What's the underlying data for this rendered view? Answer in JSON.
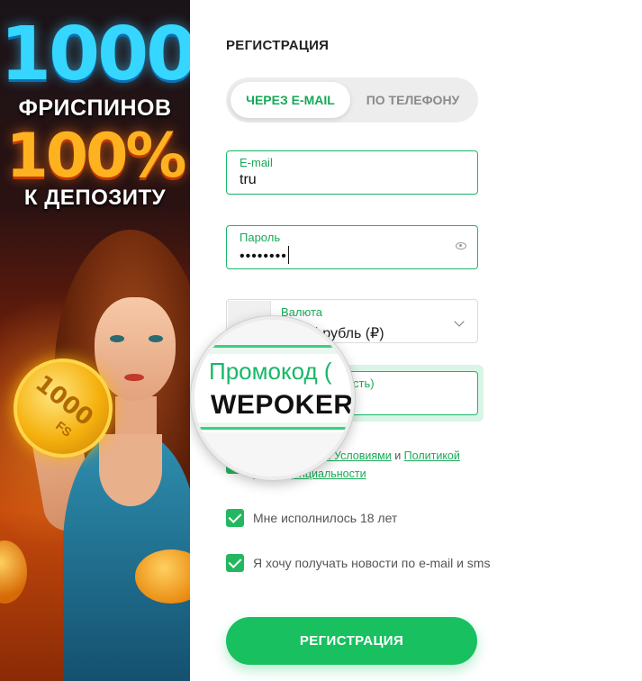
{
  "banner": {
    "big_number": "1000",
    "freespins": "ФРИСПИНОВ",
    "percent": "100%",
    "deposit": "К ДЕПОЗИТУ",
    "coin_number": "1000",
    "coin_sub": "FS"
  },
  "form": {
    "title": "РЕГИСТРАЦИЯ",
    "tabs": [
      {
        "label": "ЧЕРЕЗ E-MAIL",
        "active": true
      },
      {
        "label": "ПО ТЕЛЕФОНУ",
        "active": false
      }
    ],
    "email": {
      "label": "E-mail",
      "value": "tru"
    },
    "password": {
      "label": "Пароль",
      "value": "••••••••"
    },
    "currency": {
      "label": "Валюта",
      "value": "йский рубль (₽)"
    },
    "promo": {
      "label": "Промокод (",
      "tail": "сть)",
      "value": "WEPOKER"
    },
    "terms": {
      "prefix": "с",
      "link1": "Правилами и Условиями",
      "and": "и",
      "link2": "Политикой",
      "link2_cont": "конфиденциальности"
    },
    "age_check": {
      "label": "Мне исполнилось 18 лет",
      "checked": true
    },
    "news_check": {
      "label": "Я хочу получать новости по e-mail и sms",
      "checked": true
    },
    "submit_label": "РЕГИСТРАЦИЯ"
  },
  "colors": {
    "accent": "#18c060",
    "accent_text": "#18a957",
    "tab_bg": "#ededed"
  },
  "icons": [
    "eye-icon",
    "chevron-down-icon",
    "checkbox-check-icon",
    "coin-icon"
  ]
}
